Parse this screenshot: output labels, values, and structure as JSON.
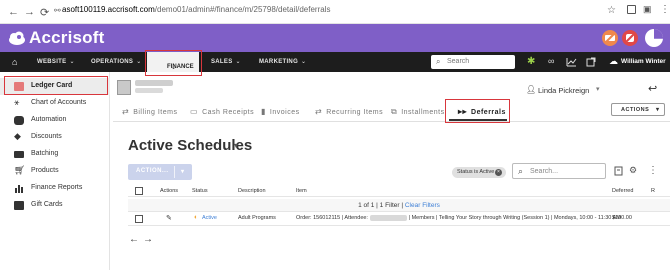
{
  "browser": {
    "url_host": "asoft100119.accrisoft.com",
    "url_path": "/demo01/admin#/finance/m/25798/detail/deferrals"
  },
  "app": {
    "brand": "Accrisoft",
    "accent": "#7f5fc7",
    "nav_bar_color": "#1d1d1d",
    "header_icons": [
      "forbidden-orange-icon",
      "forbidden-red-icon",
      "pie-chart-icon"
    ]
  },
  "nav": {
    "items": [
      {
        "label": "WEBSITE",
        "dropdown": true
      },
      {
        "label": "OPERATIONS",
        "dropdown": true
      },
      {
        "label": "FINANCE",
        "dropdown": true,
        "active": true
      },
      {
        "label": "SALES",
        "dropdown": true
      },
      {
        "label": "MARKETING",
        "dropdown": true
      }
    ],
    "search_placeholder": "Search",
    "user": "William Winter",
    "tool_icons": [
      "gear-icon",
      "link-icon",
      "chart-icon",
      "external-link-icon"
    ]
  },
  "sidebar": {
    "items": [
      {
        "label": "Ledger Card",
        "icon": "ledger-icon",
        "active": true
      },
      {
        "label": "Chart of Accounts",
        "icon": "accounts-icon"
      },
      {
        "label": "Automation",
        "icon": "robot-icon"
      },
      {
        "label": "Discounts",
        "icon": "tag-icon"
      },
      {
        "label": "Batching",
        "icon": "folder-icon"
      },
      {
        "label": "Products",
        "icon": "cart-icon"
      },
      {
        "label": "Finance Reports",
        "icon": "bar-chart-icon"
      },
      {
        "label": "Gift Cards",
        "icon": "gift-icon"
      }
    ]
  },
  "account": {
    "owner": "Linda Pickreign"
  },
  "tabs": [
    {
      "label": "Billing Items",
      "icon": "arrows-icon"
    },
    {
      "label": "Cash Receipts",
      "icon": "cash-icon"
    },
    {
      "label": "Invoices",
      "icon": "invoice-icon"
    },
    {
      "label": "Recurring Items",
      "icon": "recurring-icon"
    },
    {
      "label": "Installments",
      "icon": "installments-icon"
    },
    {
      "label": "Deferrals",
      "icon": "fast-forward-icon",
      "active": true
    }
  ],
  "actions_label": "ACTIONS",
  "page": {
    "title": "Active Schedules",
    "bulk_action_label": "ACTION...",
    "filter_chip": "Status is Active",
    "search_placeholder": "Search..."
  },
  "grid": {
    "columns": [
      "Actions",
      "Status",
      "Description",
      "Item",
      "Deferred",
      "R"
    ],
    "info": {
      "pages": "1 of 1",
      "filters": "1 Filter",
      "clear": "Clear Filters"
    },
    "rows": [
      {
        "status": "Active",
        "description": "Adult Programs",
        "item_prefix": "Order: 156012115 | Attendee: ",
        "item_suffix": " | Members | Telling Your Story through Writing (Session 1) | Mondays, 10:00 - 11:30 AM",
        "deferred": "$100.00"
      }
    ]
  }
}
